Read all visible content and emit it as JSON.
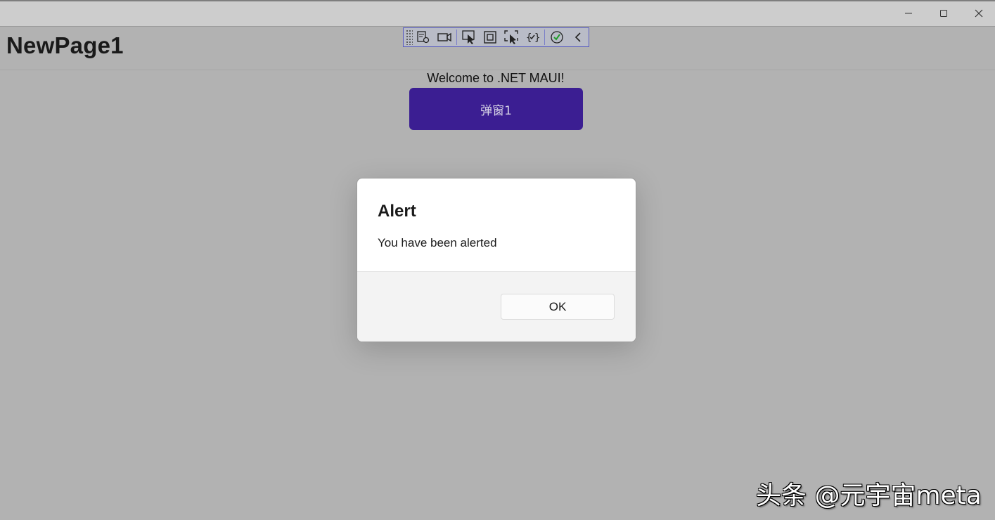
{
  "window": {
    "controls": {
      "minimize_icon": "minimize-icon",
      "maximize_icon": "maximize-icon",
      "close_icon": "close-icon"
    }
  },
  "page": {
    "title": "NewPage1"
  },
  "debug_toolbar": {
    "icons": [
      "grip-icon",
      "live-visual-tree-icon",
      "record-icon",
      "select-element-icon",
      "display-adorners-icon",
      "track-focus-icon",
      "binding-failures-icon",
      "accessibility-check-icon",
      "collapse-chevron-icon"
    ],
    "accent": "#5a5ec0"
  },
  "main": {
    "welcome_text": "Welcome to .NET MAUI!",
    "button_label": "弹窗1",
    "button_color": "#3b1e92"
  },
  "dialog": {
    "title": "Alert",
    "message": "You have been alerted",
    "ok_label": "OK"
  },
  "watermark": {
    "text": "头条 @元宇宙meta"
  }
}
